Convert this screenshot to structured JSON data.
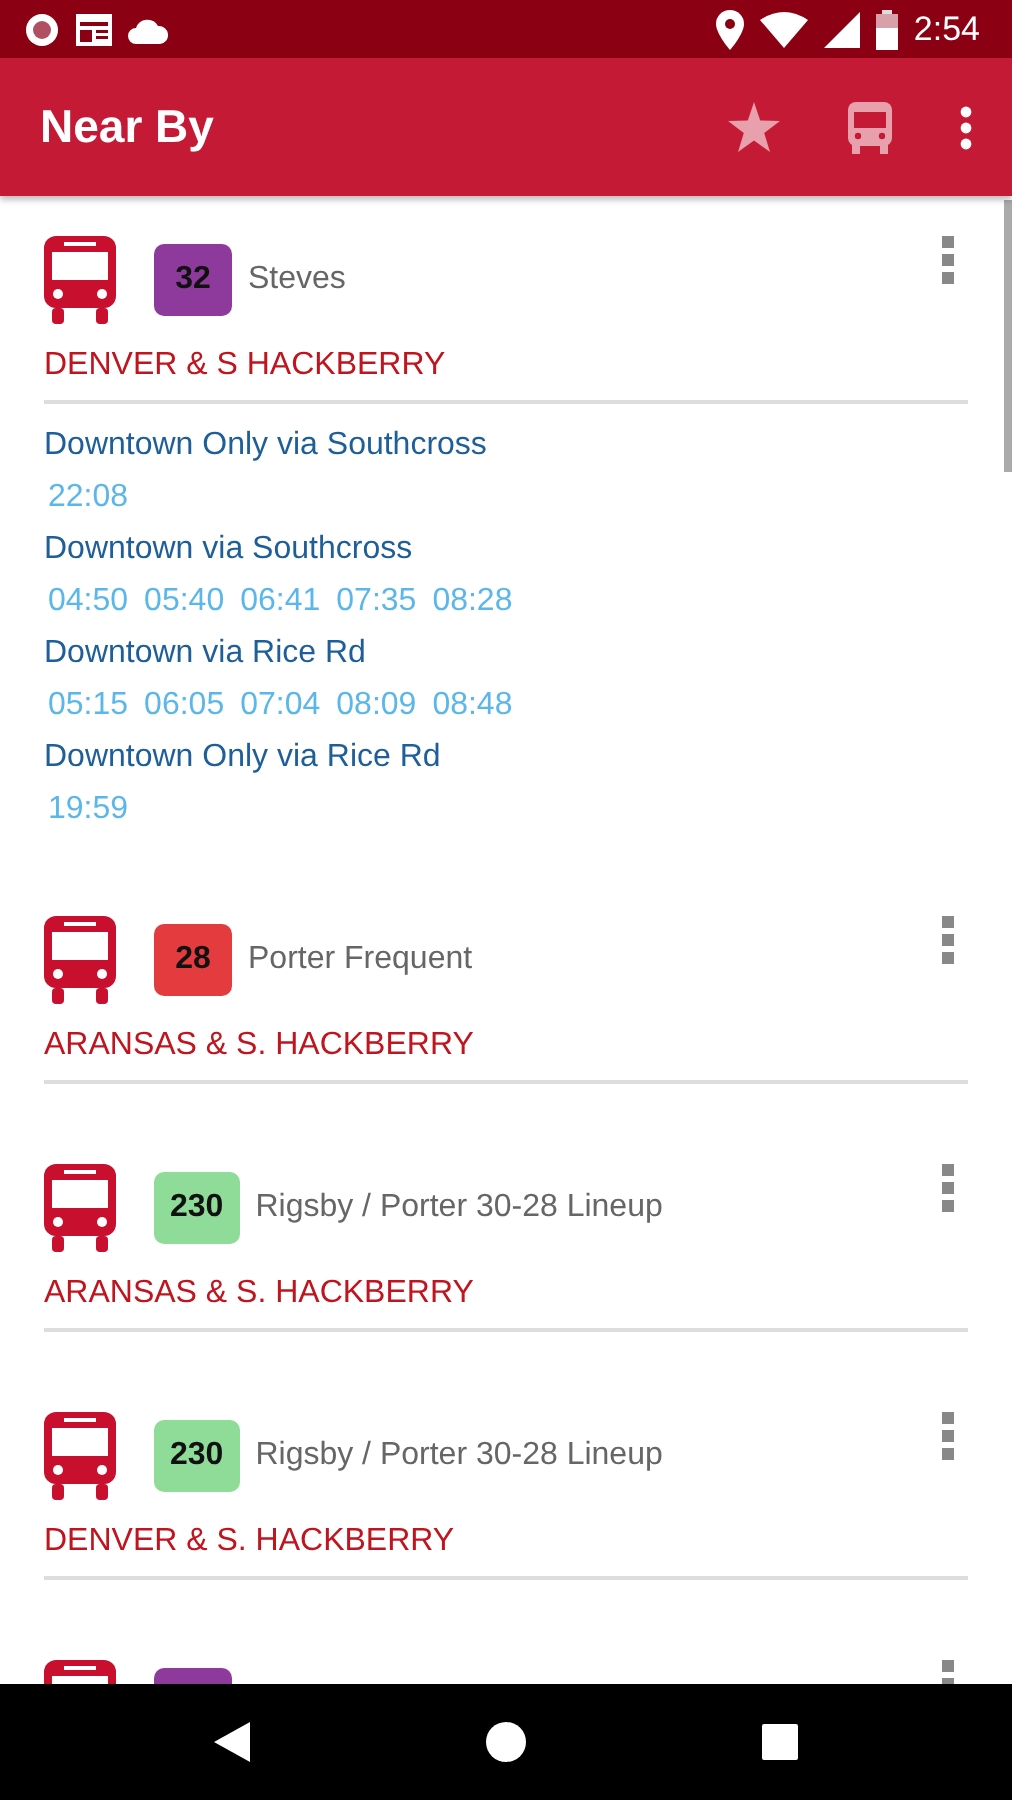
{
  "status_bar": {
    "time": "2:54"
  },
  "app_bar": {
    "title": "Near By"
  },
  "stops": [
    {
      "route_number": "32",
      "route_name": "Steves",
      "color": "#8e3a9d",
      "stop_name": "DENVER & S HACKBERRY",
      "directions": [
        {
          "name": "Downtown Only via Southcross",
          "times": [
            "22:08"
          ]
        },
        {
          "name": "Downtown via Southcross",
          "times": [
            "04:50",
            "05:40",
            "06:41",
            "07:35",
            "08:28"
          ]
        },
        {
          "name": "Downtown via Rice Rd",
          "times": [
            "05:15",
            "06:05",
            "07:04",
            "08:09",
            "08:48"
          ]
        },
        {
          "name": "Downtown Only via Rice Rd",
          "times": [
            "19:59"
          ]
        }
      ]
    },
    {
      "route_number": "28",
      "route_name": "Porter Frequent",
      "color": "#e33b3e",
      "stop_name": "ARANSAS & S. HACKBERRY"
    },
    {
      "route_number": "230",
      "route_name": "Rigsby / Porter 30-28 Lineup",
      "color": "#8edc98",
      "stop_name": "ARANSAS & S. HACKBERRY"
    },
    {
      "route_number": "230",
      "route_name": "Rigsby / Porter 30-28 Lineup",
      "color": "#8edc98",
      "stop_name": "DENVER & S. HACKBERRY"
    },
    {
      "color": "#8e3a9d"
    }
  ]
}
